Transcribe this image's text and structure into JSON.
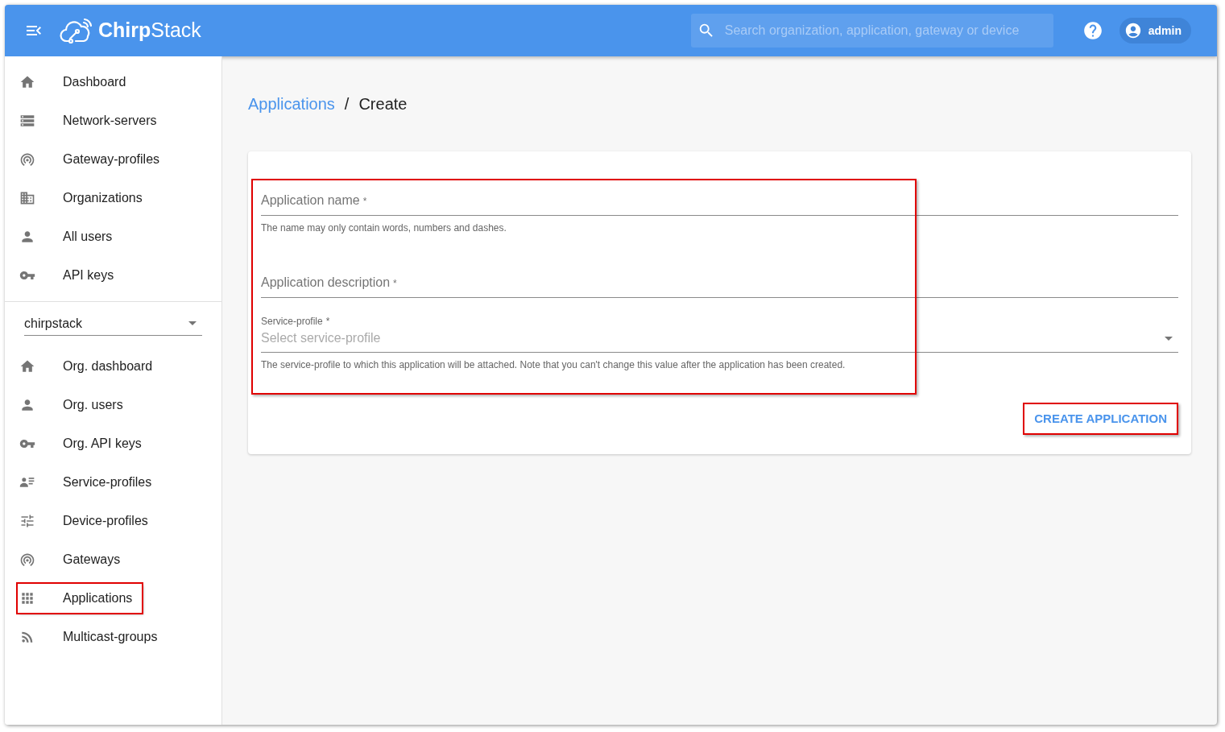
{
  "header": {
    "logo": "**Chirp**Stack",
    "search": {
      "placeholder": "Search organization, application, gateway or device"
    },
    "user": "admin"
  },
  "sidebar": {
    "items": [
      {
        "label": "Dashboard",
        "highlighted": false
      },
      {
        "label": "Network-servers",
        "highlighted": false
      },
      {
        "label": "Gateway-profiles",
        "highlighted": false
      },
      {
        "label": "Organizations",
        "highlighted": false
      },
      {
        "label": "All users",
        "highlighted": false
      },
      {
        "label": "API keys",
        "highlighted": false
      }
    ],
    "organization_select": {
      "value": "chirpstack"
    },
    "org_items": [
      {
        "label": "Org. dashboard",
        "highlighted": false
      },
      {
        "label": "Org. users",
        "highlighted": false
      },
      {
        "label": "Org. API keys",
        "highlighted": false
      },
      {
        "label": "Service-profiles",
        "highlighted": false
      },
      {
        "label": "Device-profiles",
        "highlighted": false
      },
      {
        "label": "Gateways",
        "highlighted": false
      },
      {
        "label": "Applications",
        "highlighted": true
      },
      {
        "label": "Multicast-groups",
        "highlighted": false
      }
    ]
  },
  "breadcrumb": {
    "link": "Applications",
    "separator": "/",
    "current": "Create"
  },
  "form": {
    "highlighted": true,
    "fields": [
      {
        "kind": "text",
        "label": "Application name",
        "required_mark": "*",
        "helper": "The name may only contain words, numbers and dashes."
      },
      {
        "kind": "text",
        "label": "Application description",
        "required_mark": "*"
      },
      {
        "kind": "select",
        "label": "Service-profile",
        "required_mark": "*",
        "placeholder": "Select service-profile",
        "helper": "The service-profile to which this application will be attached. Note that you can't change this value after the application has been created."
      }
    ],
    "submit": {
      "label": "CREATE APPLICATION",
      "highlighted": true
    }
  }
}
